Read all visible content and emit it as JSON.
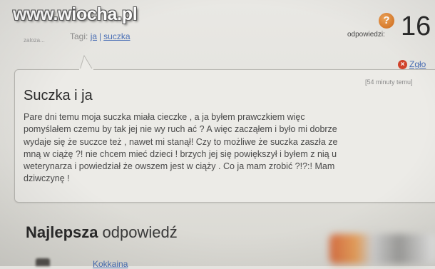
{
  "watermark": "www.wiocha.pl",
  "asker": {
    "avatar_caption": "zaloza..."
  },
  "tags": {
    "label": "Tagi:",
    "items": [
      "ja",
      "suczka"
    ]
  },
  "answers": {
    "label": "odpowiedzi:",
    "count": "16"
  },
  "report": {
    "label": "Zgło"
  },
  "question": {
    "time_ago": "[54 minuty temu]",
    "title": "Suczka i ja",
    "body_lines": [
      "Pare dni temu moja suczka miała cieczke , a ja byłem prawczkiem więc",
      "pomyślałem czemu by tak jej nie wy ruch ać ? A więc zacząłem i było mi dobrze",
      "wydaje się że suczce też , nawet mi stanął! Czy to możliwe że suczka zaszła ze",
      "mną w ciążę ?! nie chcem mieć dzieci ! brzych jej się powiększył i byłem z nią u",
      "weterynarza i powiedział że owszem jest w ciąży . Co ja mam zrobić ?!?:! Mam",
      "dziwczynę !"
    ]
  },
  "best_answer": {
    "title_bold": "Najlepsza",
    "title_rest": "odpowiedź",
    "user": "Kokkaina"
  }
}
